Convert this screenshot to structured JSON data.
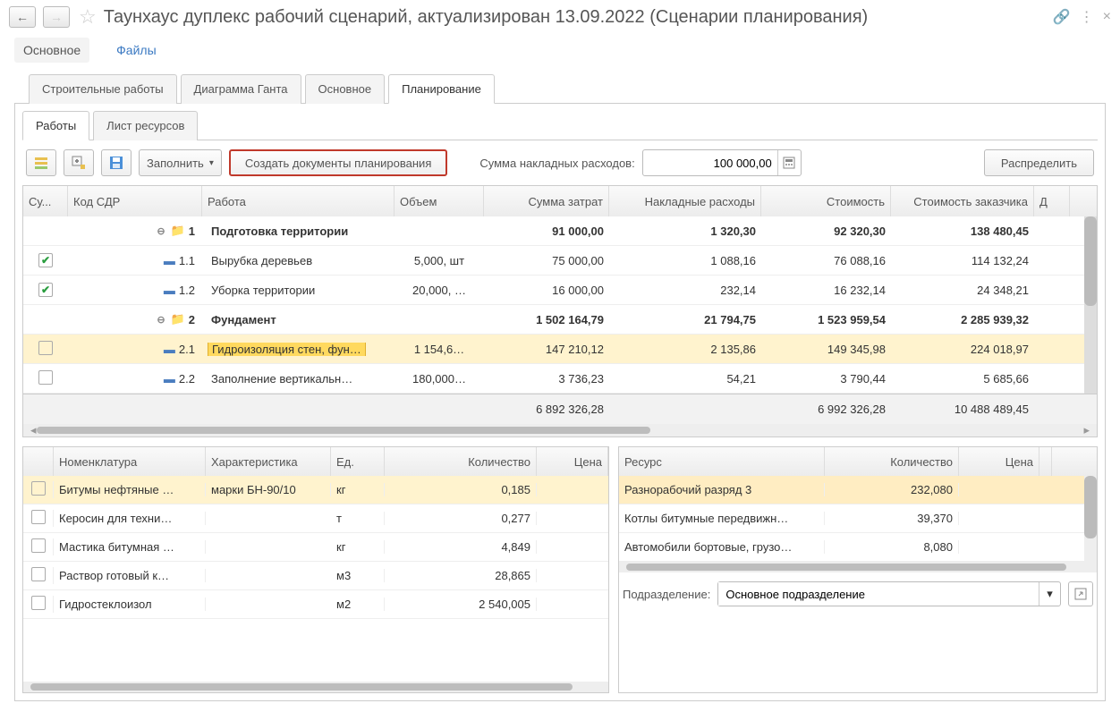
{
  "header": {
    "title": "Таунхаус дуплекс рабочий сценарий, актуализирован 13.09.2022 (Сценарии планирования)"
  },
  "subheader": {
    "main": "Основное",
    "files": "Файлы"
  },
  "tabs_top": {
    "construction": "Строительные работы",
    "gantt": "Диаграмма Ганта",
    "main": "Основное",
    "planning": "Планирование"
  },
  "tabs_inner": {
    "works": "Работы",
    "resources": "Лист ресурсов"
  },
  "toolbar": {
    "fill": "Заполнить",
    "create_docs": "Создать документы планирования",
    "overhead_label": "Сумма накладных расходов:",
    "overhead_value": "100 000,00",
    "distribute": "Распределить"
  },
  "main_table": {
    "headers": {
      "su": "Су...",
      "code": "Код СДР",
      "work": "Работа",
      "volume": "Объем",
      "cost_sum": "Сумма затрат",
      "overhead": "Накладные расходы",
      "cost": "Стоимость",
      "cust_cost": "Стоимость заказчика",
      "d": "Д"
    },
    "rows": [
      {
        "type": "group",
        "code": "1",
        "work": "Подготовка территории",
        "volume": "",
        "cost_sum": "91 000,00",
        "overhead": "1 320,30",
        "cost": "92 320,30",
        "cust_cost": "138 480,45"
      },
      {
        "type": "item",
        "checked": true,
        "code": "1.1",
        "work": "Вырубка деревьев",
        "volume": "5,000, шт",
        "cost_sum": "75 000,00",
        "overhead": "1 088,16",
        "cost": "76 088,16",
        "cust_cost": "114 132,24"
      },
      {
        "type": "item",
        "checked": true,
        "code": "1.2",
        "work": "Уборка территории",
        "volume": "20,000, …",
        "cost_sum": "16 000,00",
        "overhead": "232,14",
        "cost": "16 232,14",
        "cust_cost": "24 348,21"
      },
      {
        "type": "group",
        "code": "2",
        "work": "Фундамент",
        "volume": "",
        "cost_sum": "1 502 164,79",
        "overhead": "21 794,75",
        "cost": "1 523 959,54",
        "cust_cost": "2 285 939,32"
      },
      {
        "type": "item",
        "checked": false,
        "selected": true,
        "code": "2.1",
        "work": "Гидроизоляция стен, фун…",
        "volume": "1 154,6…",
        "cost_sum": "147 210,12",
        "overhead": "2 135,86",
        "cost": "149 345,98",
        "cust_cost": "224 018,97"
      },
      {
        "type": "item",
        "checked": false,
        "code": "2.2",
        "work": "Заполнение вертикальн…",
        "volume": "180,000…",
        "cost_sum": "3 736,23",
        "overhead": "54,21",
        "cost": "3 790,44",
        "cust_cost": "5 685,66"
      }
    ],
    "footer": {
      "cost_sum": "6 892 326,28",
      "cost": "6 992 326,28",
      "cust_cost": "10 488 489,45"
    }
  },
  "materials": {
    "headers": {
      "nomen": "Номенклатура",
      "char": "Характеристика",
      "unit": "Ед.",
      "qty": "Количество",
      "price": "Цена"
    },
    "rows": [
      {
        "selected": true,
        "nomen": "Битумы нефтяные …",
        "char": "марки БН-90/10",
        "unit": "кг",
        "qty": "0,185"
      },
      {
        "nomen": "Керосин для техни…",
        "char": "",
        "unit": "т",
        "qty": "0,277"
      },
      {
        "nomen": "Мастика битумная …",
        "char": "",
        "unit": "кг",
        "qty": "4,849"
      },
      {
        "nomen": "Раствор готовый к…",
        "char": "",
        "unit": "м3",
        "qty": "28,865"
      },
      {
        "nomen": "Гидростеклоизол",
        "char": "",
        "unit": "м2",
        "qty": "2 540,005"
      }
    ]
  },
  "resources": {
    "headers": {
      "res": "Ресурс",
      "qty": "Количество",
      "price": "Цена"
    },
    "rows": [
      {
        "selected": true,
        "res": "Разнорабочий разряд 3",
        "qty": "232,080"
      },
      {
        "res": "Котлы битумные передвижн…",
        "qty": "39,370"
      },
      {
        "res": "Автомобили бортовые, грузо…",
        "qty": "8,080"
      }
    ]
  },
  "division": {
    "label": "Подразделение:",
    "value": "Основное подразделение"
  }
}
